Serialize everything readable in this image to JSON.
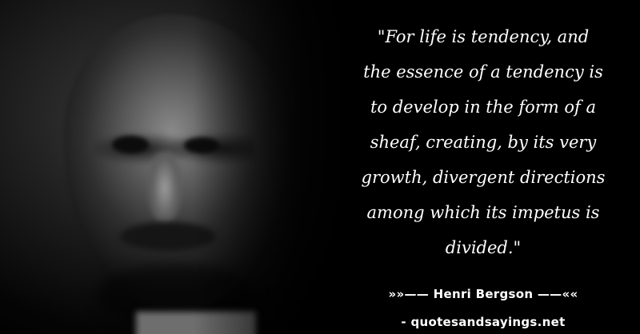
{
  "quote": {
    "lines": [
      "\"For life is tendency, and",
      "the essence of a tendency is",
      "to develop in the form of a",
      "sheaf, creating, by its very",
      "growth, divergent directions",
      "among which its impetus is",
      "divided.\""
    ]
  },
  "attribution": {
    "author_line": "»»—— Henri Bergson ——««",
    "source_line": "- quotesandsayings.net"
  },
  "colors": {
    "background": "#000000",
    "text": "#ffffff"
  }
}
